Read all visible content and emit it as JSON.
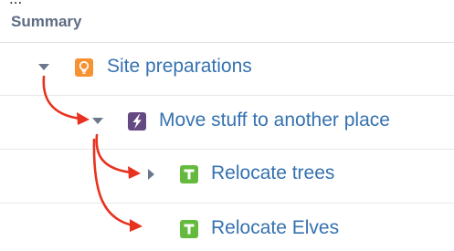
{
  "partial_top_text": "...",
  "column_header": "Summary",
  "rows": [
    {
      "label": "Site preparations",
      "icon": "lightbulb-icon",
      "icon_color": "#f79232",
      "expander": "collapse"
    },
    {
      "label": "Move stuff to another place",
      "icon": "lightning-bolt-icon",
      "icon_color": "#654982",
      "expander": "collapse"
    },
    {
      "label": "Relocate trees",
      "icon": "task-t-icon",
      "icon_color": "#63ba3c",
      "expander": "expand"
    },
    {
      "label": "Relocate Elves",
      "icon": "task-t-icon",
      "icon_color": "#63ba3c",
      "expander": "none"
    }
  ],
  "colors": {
    "link": "#3572b0",
    "header_text": "#5e6c84",
    "annotation_arrow": "#e8321f",
    "caret": "#6b778c"
  }
}
